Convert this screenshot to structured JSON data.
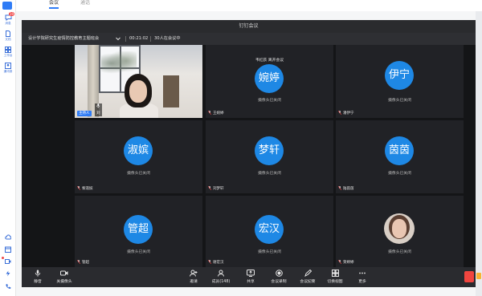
{
  "host_app": {
    "tabs": [
      {
        "label": "会议",
        "active": true
      },
      {
        "label": "通话",
        "active": false
      }
    ],
    "sidebar": [
      {
        "label": "消息",
        "icon": "chat-icon",
        "badge": "19"
      },
      {
        "label": "文档",
        "icon": "document-icon"
      },
      {
        "label": "工作台",
        "icon": "workbench-icon"
      },
      {
        "label": "通讯录",
        "icon": "contacts-icon"
      }
    ],
    "sidebar_bottom_icons": [
      "cloud-icon",
      "calendar-icon",
      "meeting-icon",
      "flash-icon",
      "phone-icon"
    ]
  },
  "meeting": {
    "window_title": "钉钉会议",
    "info": {
      "meeting_name": "设计学院研究生疫情防控教育主题班会",
      "elapsed": "00:21:02",
      "participants": "30人在会议中"
    },
    "notice": "韦红荻 离开会议",
    "cam_off_text": "摄像头已关闭",
    "host": {
      "tag": "主持人",
      "name": "刘"
    },
    "tiles": [
      {
        "kind": "video",
        "name": "王伟人"
      },
      {
        "kind": "avatar",
        "avatar_text": "婉婷",
        "name": "王婉婷"
      },
      {
        "kind": "avatar",
        "avatar_text": "伊宁",
        "name": "潘伊宁"
      },
      {
        "kind": "avatar",
        "avatar_text": "淑嫔",
        "name": "黎淑嫔"
      },
      {
        "kind": "avatar",
        "avatar_text": "梦轩",
        "name": "刘梦轩"
      },
      {
        "kind": "avatar",
        "avatar_text": "茵茵",
        "name": "陆茵茵"
      },
      {
        "kind": "avatar",
        "avatar_text": "管超",
        "name": "管超"
      },
      {
        "kind": "avatar",
        "avatar_text": "宏汉",
        "name": "谢宏汉"
      },
      {
        "kind": "photo",
        "name": "贺婷婷"
      }
    ],
    "toolbar": {
      "left": [
        {
          "label": "静音",
          "icon": "microphone-icon"
        },
        {
          "label": "关摄像头",
          "icon": "camera-icon"
        }
      ],
      "center": [
        {
          "label": "邀请",
          "icon": "invite-icon"
        },
        {
          "label": "成员(148)",
          "icon": "members-icon"
        },
        {
          "label": "共享",
          "icon": "share-screen-icon"
        },
        {
          "label": "会议录制",
          "icon": "record-icon"
        },
        {
          "label": "会议纪要",
          "icon": "minutes-icon"
        },
        {
          "label": "切换视图",
          "icon": "grid-view-icon"
        },
        {
          "label": "更多",
          "icon": "more-icon"
        }
      ]
    }
  },
  "colors": {
    "accent": "#2f7cf6",
    "avatar_bg": "#1e88e5",
    "meeting_bg": "#1e1f22",
    "danger": "#f0453f"
  }
}
